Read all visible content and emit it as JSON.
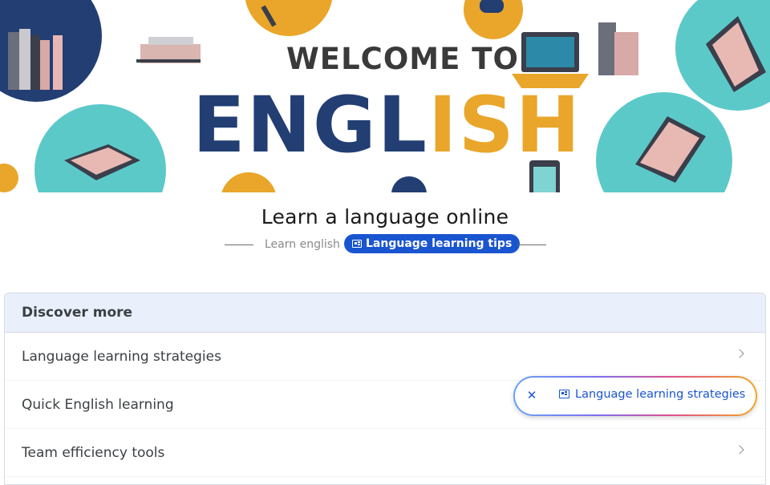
{
  "banner": {
    "welcome_text": "WELCOME TO",
    "english_part1": "ENGL",
    "english_part2": "ISH"
  },
  "page": {
    "title": "Learn a language online",
    "breadcrumb": "Learn english",
    "tips_chip_label": "Language learning tips",
    "tips_chip_icon": "article-icon"
  },
  "discover": {
    "title": "Discover more",
    "items": [
      {
        "label": "Language learning strategies"
      },
      {
        "label": "Quick English learning"
      },
      {
        "label": "Team efficiency tools"
      }
    ]
  },
  "floating_pill": {
    "label": "Language learning strategies",
    "close_icon": "close-icon",
    "icon": "article-icon"
  },
  "colors": {
    "chip_blue": "#1a55d0",
    "banner_navy": "#223e73",
    "banner_gold": "#e9a62a",
    "banner_teal": "#5cc9c9",
    "header_bg": "#e9f0fc"
  }
}
